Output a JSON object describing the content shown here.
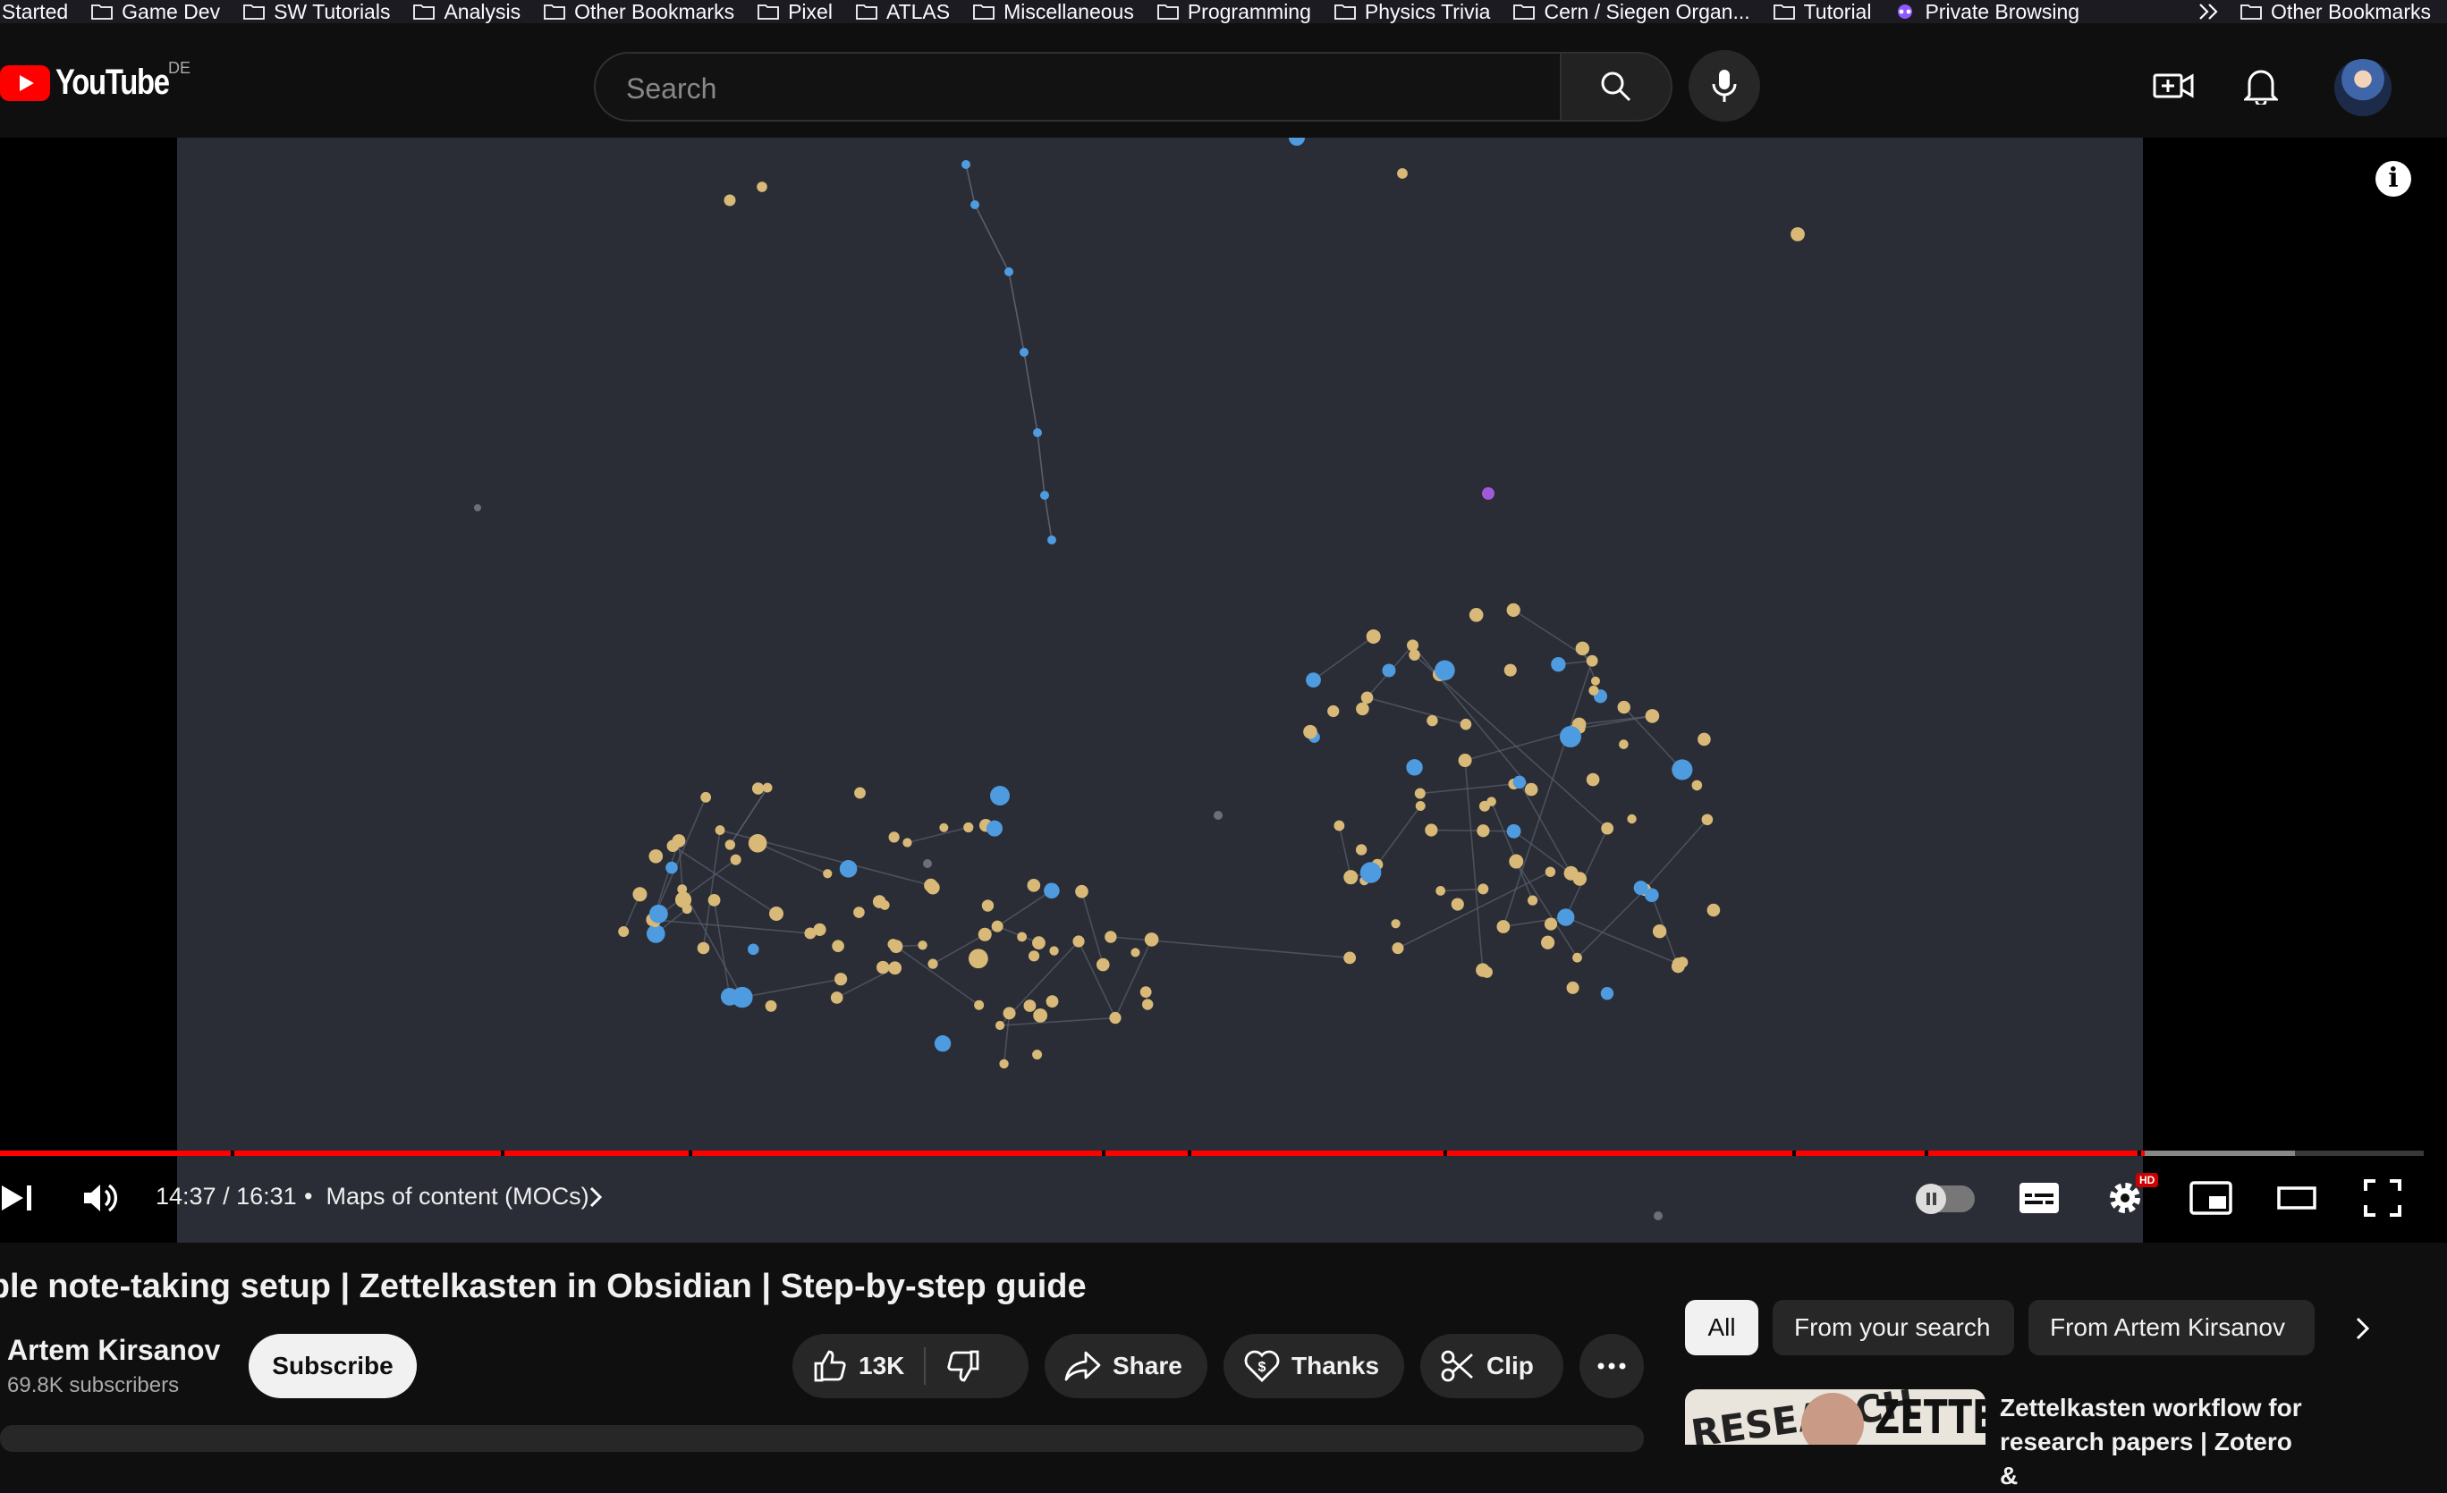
{
  "browser": {
    "bookmarks": [
      "Started",
      "Game Dev",
      "SW Tutorials",
      "Analysis",
      "Other Bookmarks",
      "Pixel",
      "ATLAS",
      "Miscellaneous",
      "Programming",
      "Physics Trivia",
      "Cern / Siegen Organ...",
      "Tutorial",
      "Private Browsing",
      "Other Bookmarks"
    ]
  },
  "header": {
    "logo_text": "YouTube",
    "region": "DE",
    "search_placeholder": "Search",
    "icons": [
      "search-icon",
      "mic-icon",
      "create-icon",
      "bell-icon",
      "avatar"
    ]
  },
  "player": {
    "time": "14:37 / 16:31",
    "chapter": "Maps of content (MOCs)",
    "progress_fraction": 0.885,
    "colors": {
      "played": "#ff0000",
      "node_gold": "#d9b978",
      "node_blue": "#4e9be0",
      "node_purple": "#a05ad8"
    }
  },
  "video": {
    "title": "mple note-taking setup | Zettelkasten in Obsidian | Step-by-step guide",
    "channel": "Artem Kirsanov",
    "subscribers": "69.8K subscribers",
    "subscribe_label": "Subscribe",
    "likes": "13K",
    "share_label": "Share",
    "thanks_label": "Thanks",
    "clip_label": "Clip"
  },
  "sidebar": {
    "chips": [
      "All",
      "From your search",
      "From Artem Kirsanov"
    ],
    "recommended": {
      "title": "Zettelkasten workflow for research papers | Zotero &",
      "thumb_text_left": "RESEARCH",
      "thumb_text_right": "ZETTEL"
    }
  }
}
